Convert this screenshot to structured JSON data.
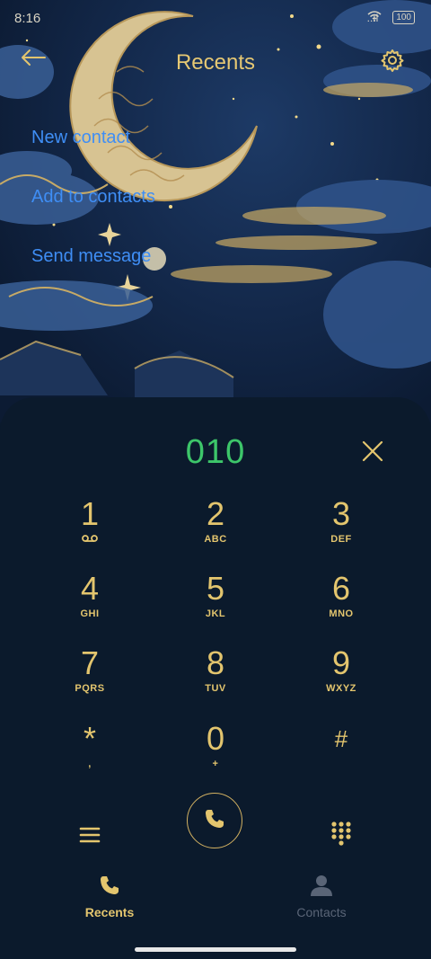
{
  "status_bar": {
    "time": "8:16",
    "signal": "..ıl",
    "battery": "100"
  },
  "header": {
    "title": "Recents"
  },
  "actions": [
    {
      "label": "New contact"
    },
    {
      "label": "Add to contacts"
    },
    {
      "label": "Send message"
    }
  ],
  "dialer": {
    "entered_number": "010",
    "keys": [
      {
        "digit": "1",
        "sub": ""
      },
      {
        "digit": "2",
        "sub": "ABC"
      },
      {
        "digit": "3",
        "sub": "DEF"
      },
      {
        "digit": "4",
        "sub": "GHI"
      },
      {
        "digit": "5",
        "sub": "JKL"
      },
      {
        "digit": "6",
        "sub": "MNO"
      },
      {
        "digit": "7",
        "sub": "PQRS"
      },
      {
        "digit": "8",
        "sub": "TUV"
      },
      {
        "digit": "9",
        "sub": "WXYZ"
      },
      {
        "digit": "*",
        "sub": ","
      },
      {
        "digit": "0",
        "sub": "+"
      },
      {
        "digit": "#",
        "sub": ""
      }
    ]
  },
  "tabs": [
    {
      "label": "Recents",
      "active": true
    },
    {
      "label": "Contacts",
      "active": false
    }
  ],
  "colors": {
    "accent_gold": "#e3c56e",
    "number_green": "#3dc66a",
    "link_blue": "#3f8ef5",
    "panel_bg": "#0b1a2c"
  }
}
